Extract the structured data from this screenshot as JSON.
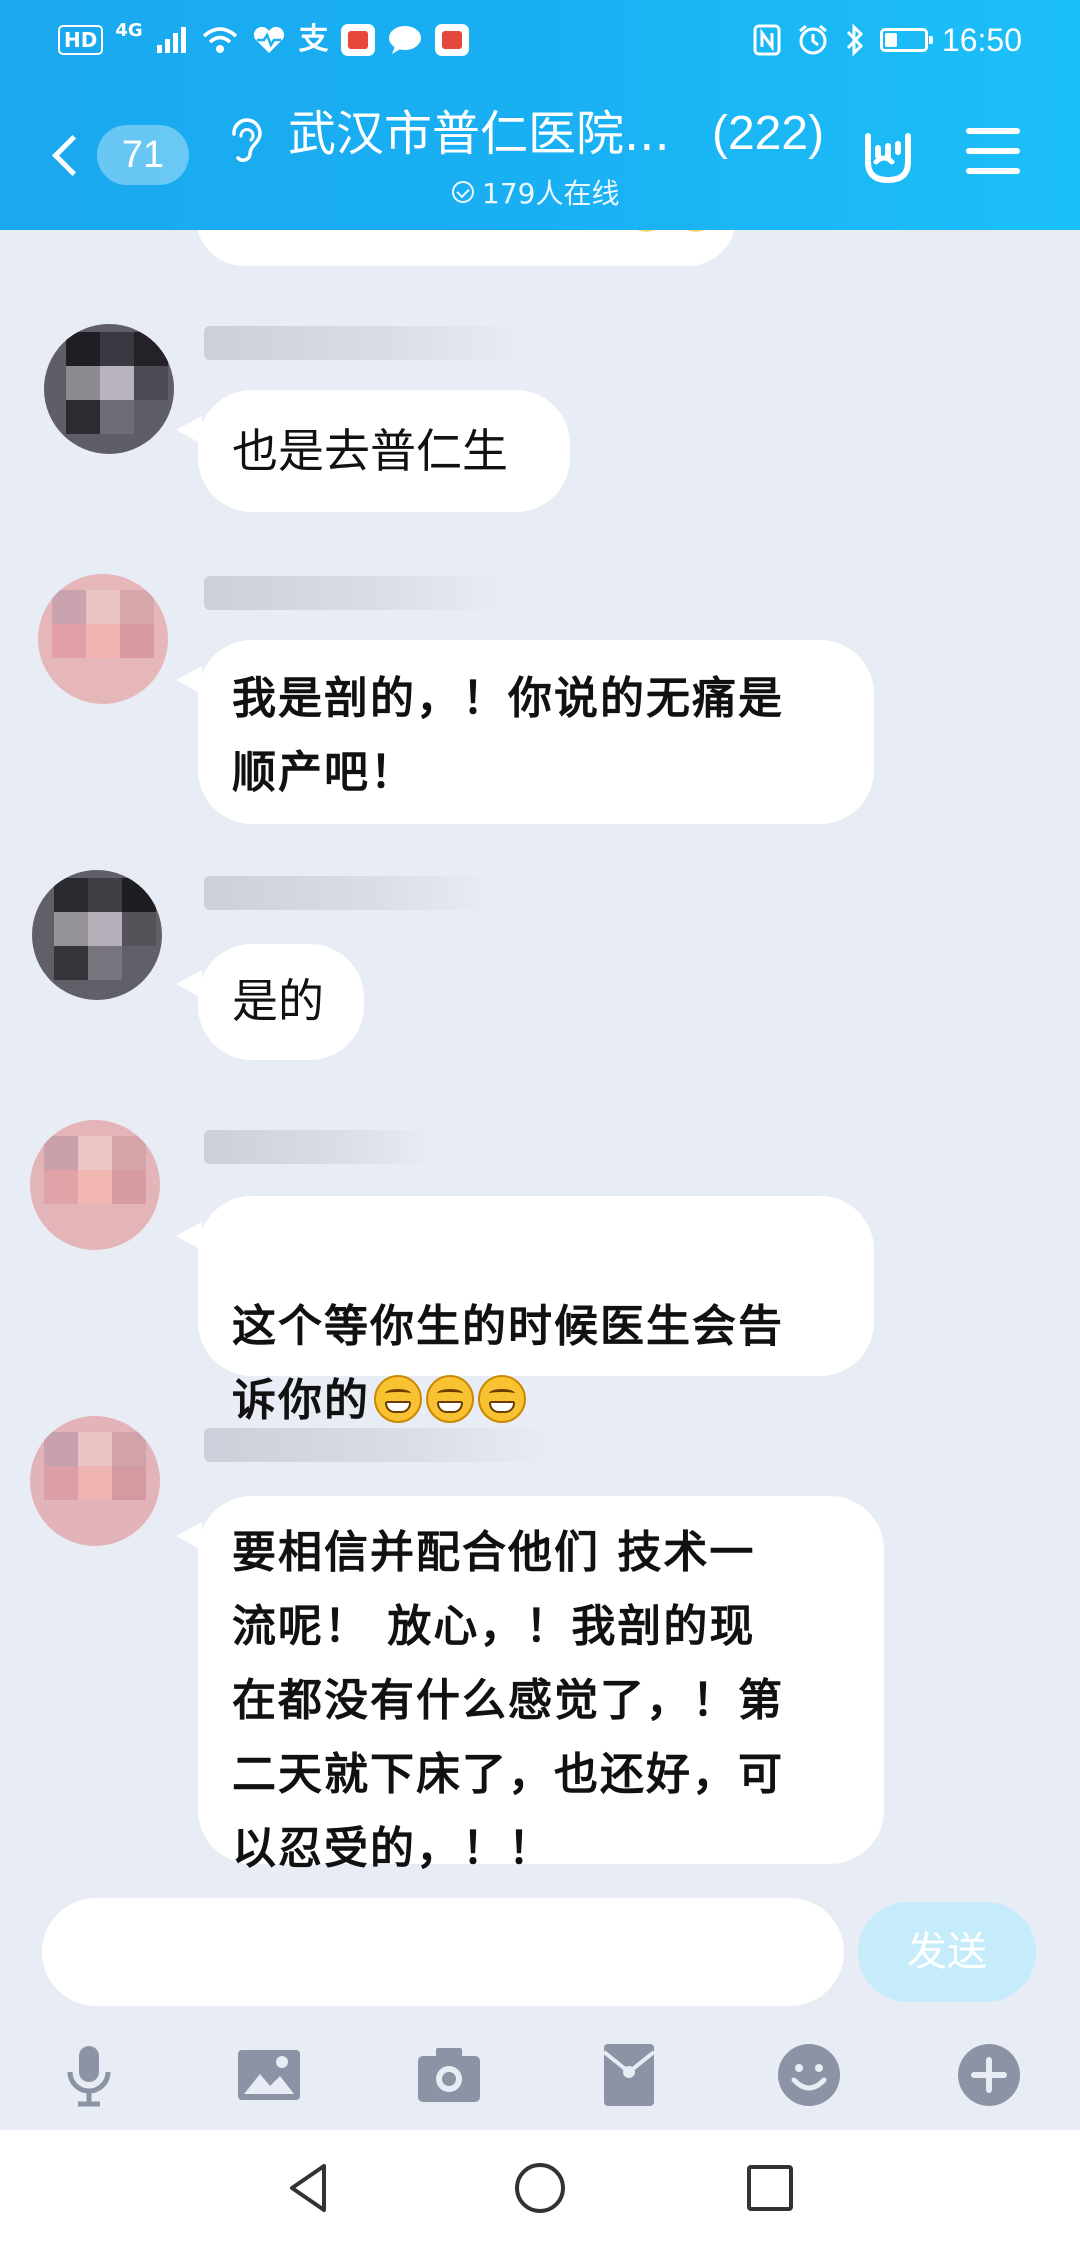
{
  "status_bar": {
    "network_badge": "HD",
    "signal_label": "4G",
    "pay_glyph": "支",
    "time": "16:50"
  },
  "header": {
    "unread_count": "71",
    "title": "武汉市普仁医院...",
    "member_count": "(222)",
    "online_text": "179人在线"
  },
  "messages": [
    {
      "sender_visible": false,
      "text": "也是去普仁生",
      "style": "normal"
    },
    {
      "sender_visible": false,
      "text": "我是剖的，！你说的无痛是\n顺产吧！",
      "style": "hand"
    },
    {
      "sender_visible": false,
      "text": "是的",
      "style": "normal"
    },
    {
      "sender_visible": false,
      "text": "这个等你生的时候医生会告\n诉你的",
      "style": "hand",
      "emoji_count": 3
    },
    {
      "sender_visible": false,
      "text": "要相信并配合他们    技术一\n流呢！  放心，！我剖的现\n在都没有什么感觉了，！第\n二天就下床了，也还好，可\n以忍受的，！！",
      "style": "hand"
    }
  ],
  "input": {
    "placeholder": "",
    "send_label": "发送"
  },
  "toolbar": {
    "icons": [
      "microphone-icon",
      "image-icon",
      "camera-icon",
      "red-packet-icon",
      "emoji-icon",
      "plus-icon"
    ]
  },
  "colors": {
    "header_blue": "#19b0f3",
    "background": "#e8ecf5",
    "bubble": "#ffffff",
    "send_disabled": "#c6ebfb",
    "toolbar_icon": "#8c93a4"
  }
}
